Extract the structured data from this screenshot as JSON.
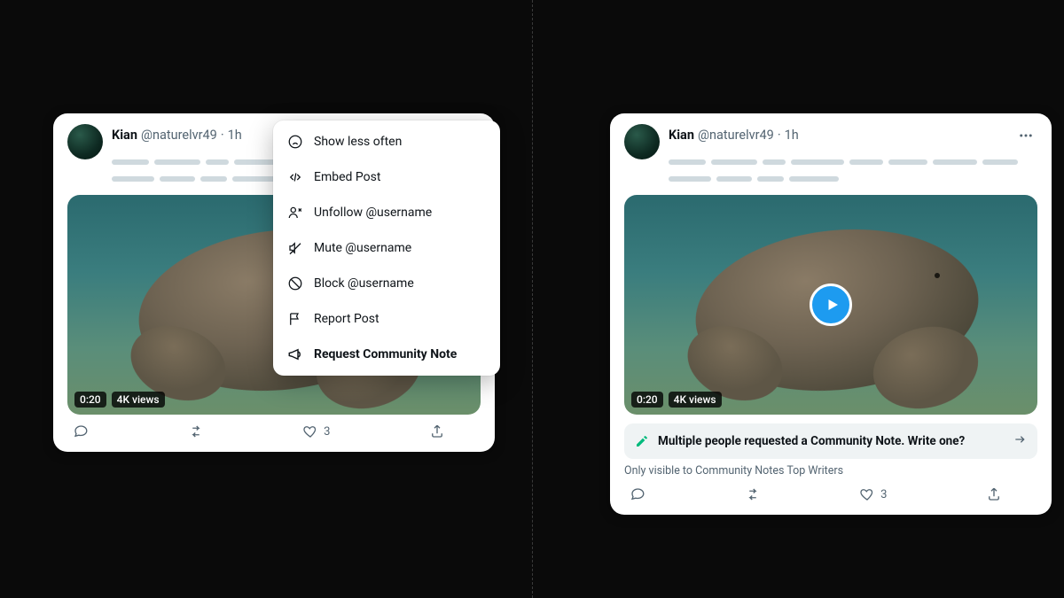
{
  "post": {
    "display_name": "Kian",
    "handle": "@naturelvr49",
    "separator": "·",
    "time": "1h",
    "video_duration": "0:20",
    "views": "4K views",
    "like_count": "3"
  },
  "menu": {
    "show_less": "Show less often",
    "embed": "Embed Post",
    "unfollow": "Unfollow @username",
    "mute": "Mute @username",
    "block": "Block @username",
    "report": "Report Post",
    "request_note": "Request Community Note"
  },
  "community_note": {
    "prompt": "Multiple people requested a Community Note. Write one?",
    "sub": "Only visible to Community Notes Top Writers"
  },
  "colors": {
    "accent": "#1d9bf0",
    "text_secondary": "#536471"
  }
}
